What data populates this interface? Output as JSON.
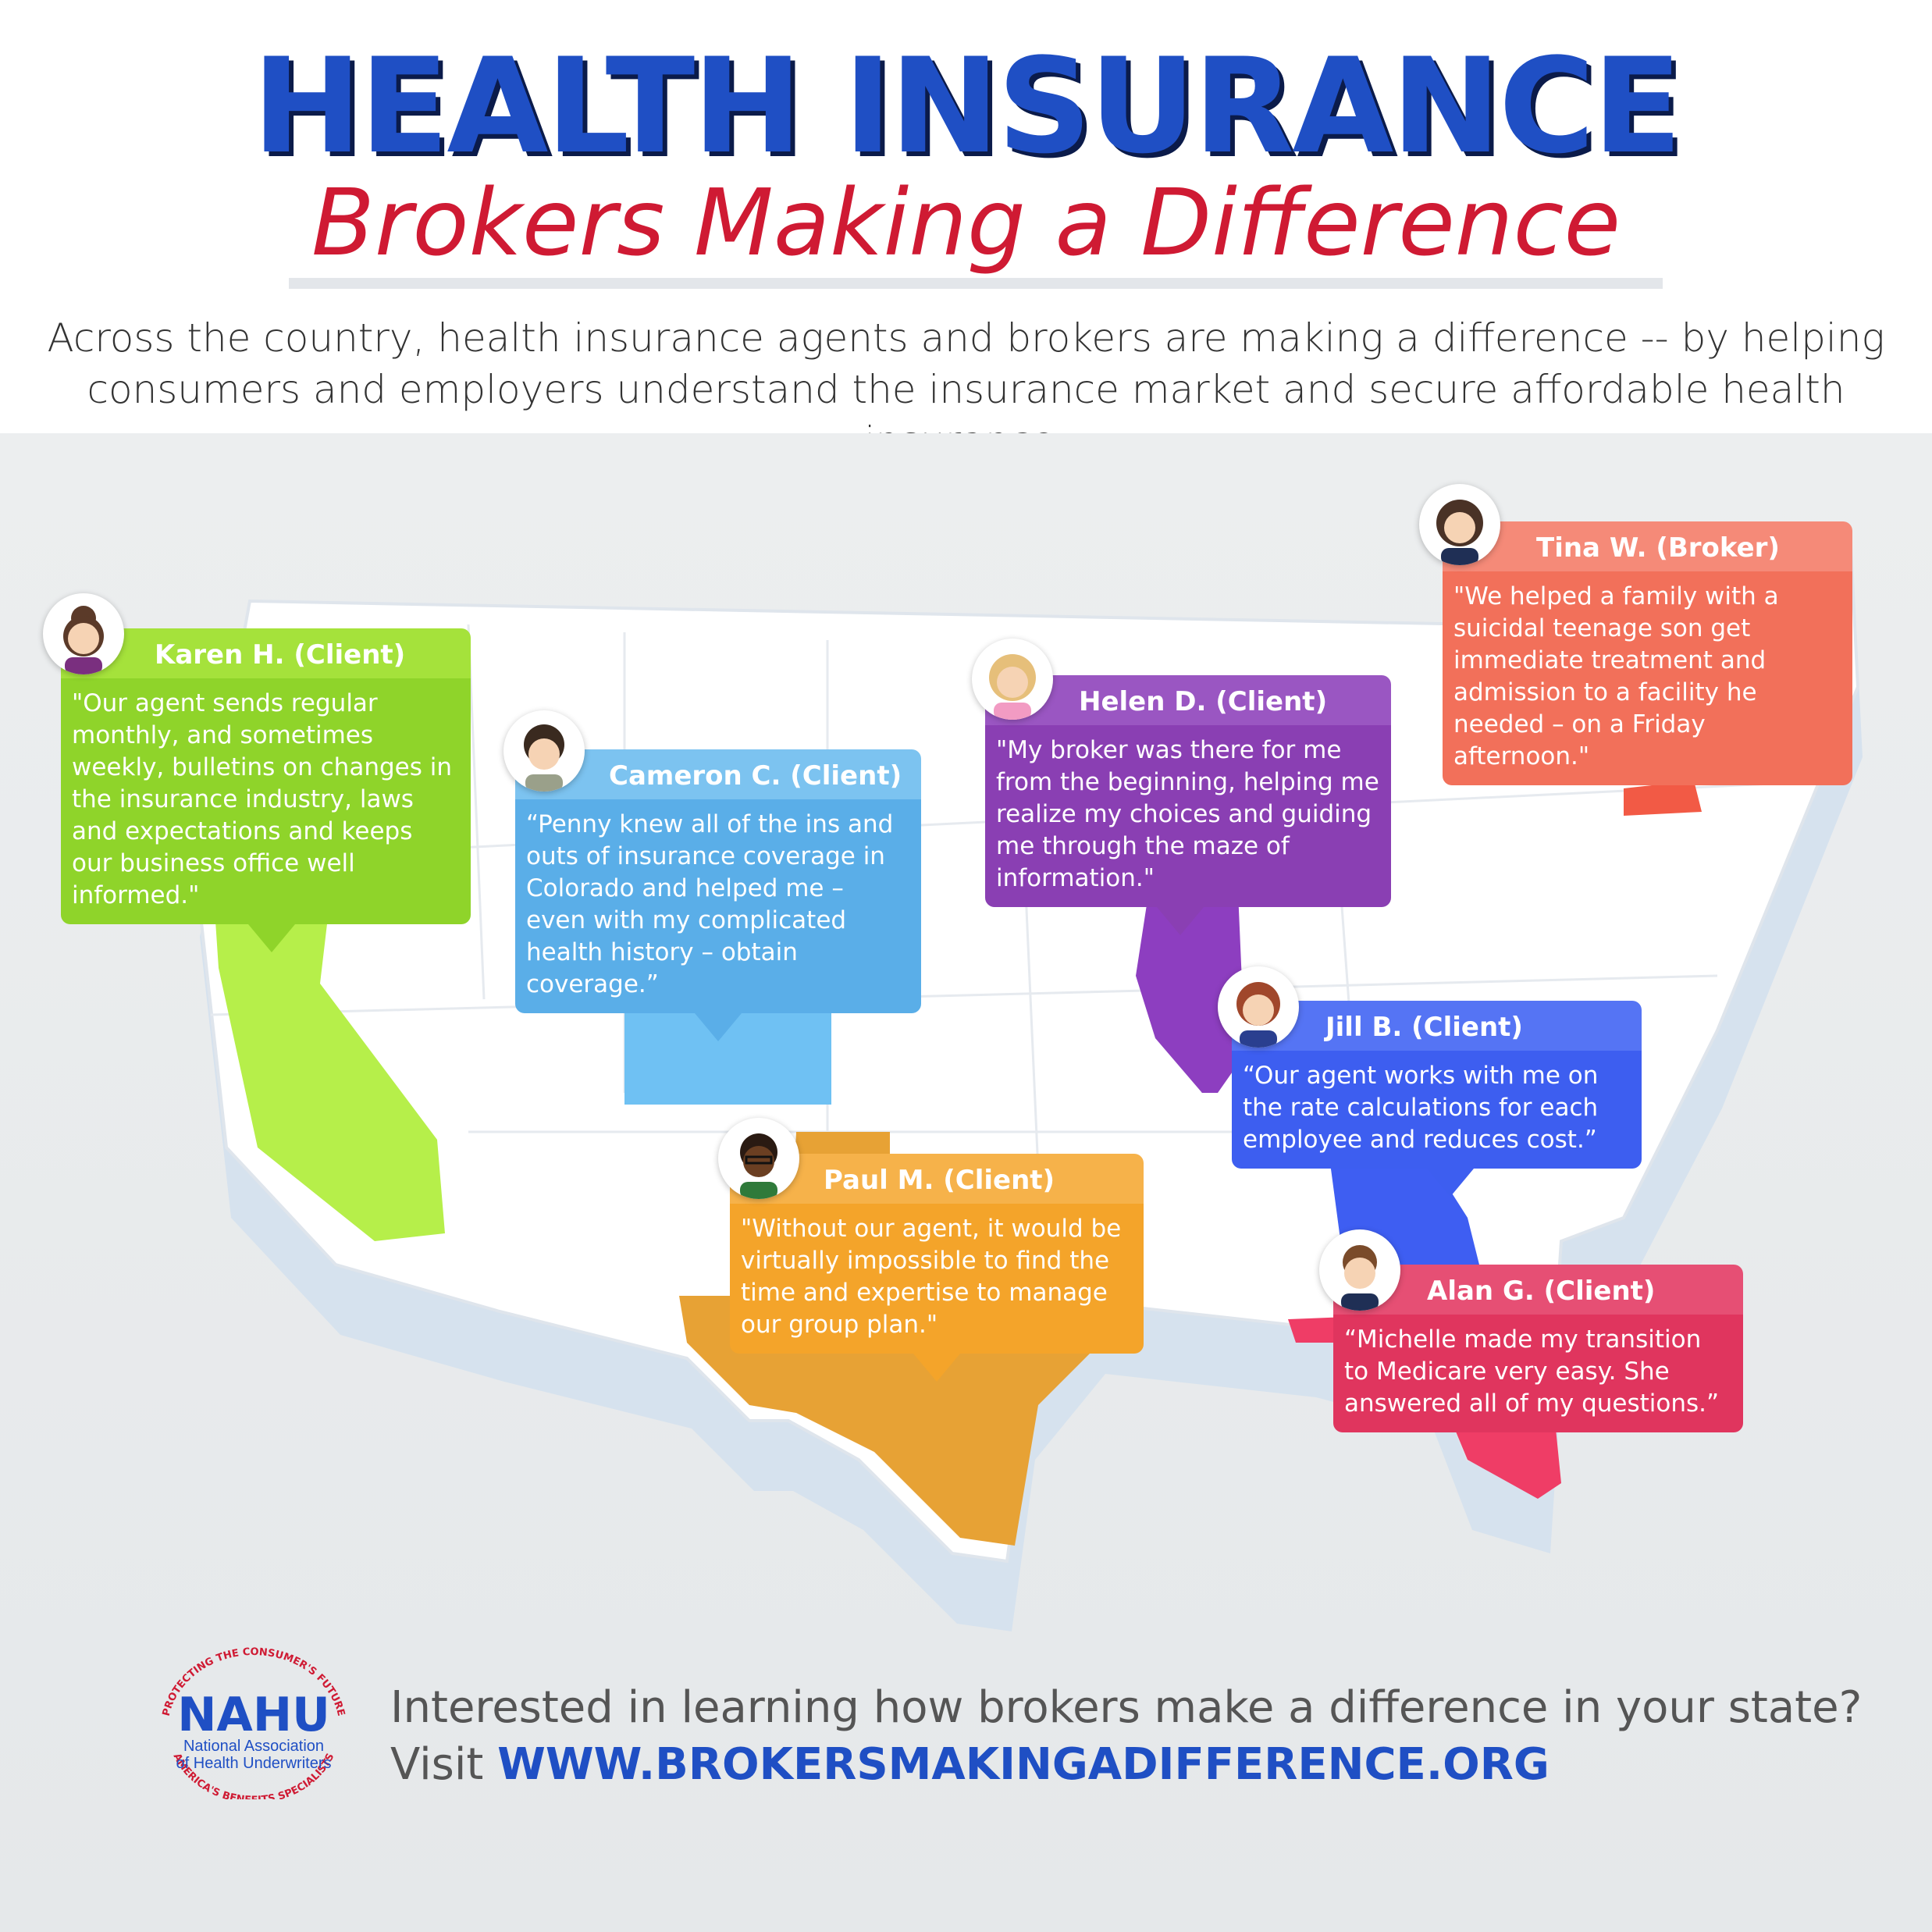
{
  "header": {
    "title": "HEALTH INSURANCE",
    "subtitle": "Brokers Making a Difference",
    "intro_line1": "Across the country, health insurance agents and brokers are making a difference -- by helping",
    "intro_line2": "consumers and employers understand the insurance market and secure affordable health insurance."
  },
  "testimonials": [
    {
      "name": "Karen H. (Client)",
      "quote": "\"Our agent sends regular monthly, and sometimes weekly, bulletins on changes in the insurance industry, laws and expectations and keeps our business office well informed.\"",
      "color": "#8fd42a",
      "state": "California"
    },
    {
      "name": "Cameron C. (Client)",
      "quote": "“Penny knew all of the ins and outs of insurance coverage in Colorado and helped me – even with my complicated health history – obtain coverage.”",
      "color": "#5aaee8",
      "state": "Colorado"
    },
    {
      "name": "Helen D. (Client)",
      "quote": "\"My broker was there for me from the beginning, helping me realize my choices and guiding me through the maze of information.\"",
      "color": "#8a3fb3",
      "state": "Illinois"
    },
    {
      "name": "Tina W. (Broker)",
      "quote": "\"We helped a family with a suicidal teenage son get immediate treatment and admission to a facility he needed – on a Friday afternoon.\"",
      "color": "#f2705a",
      "state": "Massachusetts"
    },
    {
      "name": "Jill B. (Client)",
      "quote": "“Our agent works with me on the rate calculations for each employee and reduces cost.”",
      "color": "#3d5ef0",
      "state": "Georgia"
    },
    {
      "name": "Paul M. (Client)",
      "quote": "\"Without our agent, it would be virtually impossible to find the time and expertise to manage our group plan.\"",
      "color": "#f4a42a",
      "state": "Texas"
    },
    {
      "name": "Alan G. (Client)",
      "quote": "“Michelle made my transition to Medicare very easy. She answered all of my questions.”",
      "color": "#e0355e",
      "state": "Florida"
    }
  ],
  "footer": {
    "logo_text": "NAHU",
    "logo_sub1": "National Association",
    "logo_sub2": "of Health Underwriters",
    "logo_ring_top": "PROTECTING THE CONSUMER'S FUTURE",
    "logo_ring_bottom": "AMERICA'S BENEFITS SPECIALISTS",
    "question": "Interested in learning how brokers make a difference in your state?",
    "visit_label": "Visit ",
    "url": "WWW.BROKERSMAKINGADIFFERENCE.ORG"
  },
  "colors": {
    "title_blue": "#1f4fc4",
    "subtitle_red": "#cf1a33",
    "map_white": "#ffffff",
    "map_side": "#d9e3ef"
  }
}
